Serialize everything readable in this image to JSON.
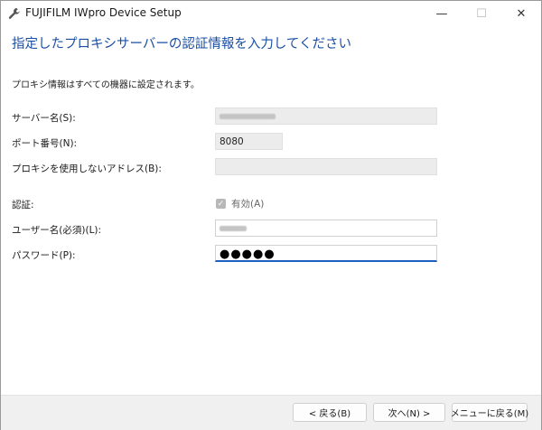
{
  "window": {
    "title": "FUJIFILM IWpro Device Setup",
    "minimize": "—",
    "maximize": "☐",
    "close": "✕"
  },
  "heading": "指定したプロキシサーバーの認証情報を入力してください",
  "info": "プロキシ情報はすべての機器に設定されます。",
  "form": {
    "server_label": "サーバー名(S):",
    "port_label": "ポート番号(N):",
    "port_value": "8080",
    "bypass_label": "プロキシを使用しないアドレス(B):",
    "auth_label": "認証:",
    "auth_checkbox_label": "有効(A)",
    "auth_checked": true,
    "username_label": "ユーザー名(必須)(L):",
    "password_label": "パスワード(P):",
    "password_mask": "●●●●●"
  },
  "footer": {
    "back": "< 戻る(B)",
    "next": "次へ(N) >",
    "menu": "メニューに戻る(M)"
  },
  "colors": {
    "heading": "#1b4fa3",
    "focus_underline": "#1e5fc2"
  }
}
